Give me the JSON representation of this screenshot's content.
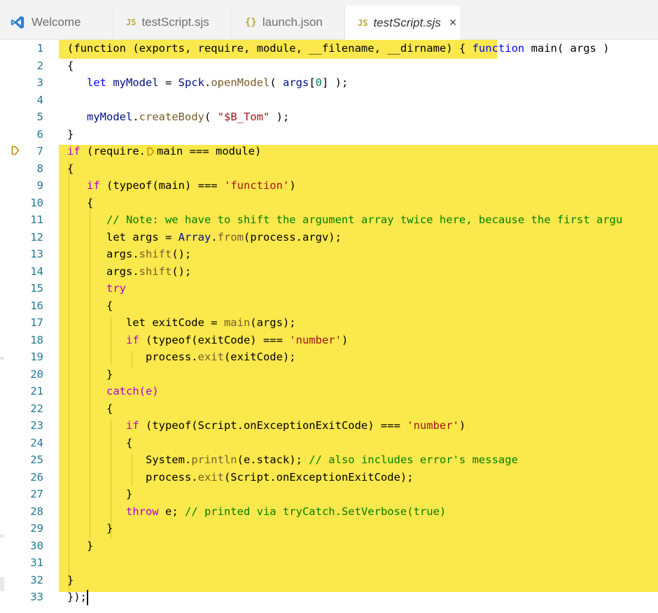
{
  "tabs": [
    {
      "icon": "vscode-logo-icon",
      "label": "Welcome"
    },
    {
      "icon": "JS",
      "label": "testScript.sjs"
    },
    {
      "icon": "{}",
      "label": "launch.json"
    },
    {
      "icon": "JS",
      "label": "testScript.sjs",
      "close": "×"
    }
  ],
  "editor": {
    "lines": [
      {
        "n": "1"
      },
      {
        "n": "2"
      },
      {
        "n": "3"
      },
      {
        "n": "4"
      },
      {
        "n": "5"
      },
      {
        "n": "6"
      },
      {
        "n": "7"
      },
      {
        "n": "8"
      },
      {
        "n": "9"
      },
      {
        "n": "10"
      },
      {
        "n": "11"
      },
      {
        "n": "12"
      },
      {
        "n": "13"
      },
      {
        "n": "14"
      },
      {
        "n": "15"
      },
      {
        "n": "16"
      },
      {
        "n": "17"
      },
      {
        "n": "18"
      },
      {
        "n": "19"
      },
      {
        "n": "20"
      },
      {
        "n": "21"
      },
      {
        "n": "22"
      },
      {
        "n": "23"
      },
      {
        "n": "24"
      },
      {
        "n": "25"
      },
      {
        "n": "26"
      },
      {
        "n": "27"
      },
      {
        "n": "28"
      },
      {
        "n": "29"
      },
      {
        "n": "30"
      },
      {
        "n": "31"
      },
      {
        "n": "32"
      },
      {
        "n": "33"
      }
    ],
    "code": {
      "l1a": "(function (exports, require, module, __filename, __dirname) { ",
      "l1b": "function",
      "l1c": " main( args )",
      "l2": "{",
      "l3a": "   let",
      "l3b": " myModel",
      "l3c": " = ",
      "l3d": "Spck",
      "l3e": ".",
      "l3f": "openModel",
      "l3g": "( ",
      "l3h": "args",
      "l3i": "[",
      "l3j": "0",
      "l3k": "] );",
      "l5a": "   myModel",
      "l5b": ".",
      "l5c": "createBody",
      "l5d": "( ",
      "l5e": "\"$B_Tom\"",
      "l5f": " );",
      "l6": "}",
      "l7a": "if",
      "l7b": " (require.",
      "l7c": "main === module)",
      "l8": "{",
      "l9a": "   if",
      "l9b": " (typeof(main) === ",
      "l9c": "'function'",
      "l9d": ")",
      "l10": "   {",
      "l11": "      // Note: we have to shift the argument array twice here, because the first argu",
      "l12a": "      let args = ",
      "l12b": "Array",
      "l12c": ".",
      "l12d": "from",
      "l12e": "(process.argv);",
      "l13a": "      args.",
      "l13b": "shift",
      "l13c": "();",
      "l14a": "      args.",
      "l14b": "shift",
      "l14c": "();",
      "l15": "      try",
      "l16": "      {",
      "l17a": "         let exitCode = ",
      "l17b": "main",
      "l17c": "(args);",
      "l18a": "         if",
      "l18b": " (typeof(exitCode) === ",
      "l18c": "'number'",
      "l18d": ")",
      "l19a": "            process.",
      "l19b": "exit",
      "l19c": "(exitCode);",
      "l20": "      }",
      "l21": "      catch(e)",
      "l22": "      {",
      "l23a": "         if",
      "l23b": " (typeof(Script.onExceptionExitCode) === ",
      "l23c": "'number'",
      "l23d": ")",
      "l24": "         {",
      "l25a": "            System.",
      "l25b": "println",
      "l25c": "(e.stack); ",
      "l25d": "// also includes error's message",
      "l26a": "            process.",
      "l26b": "exit",
      "l26c": "(Script.onExceptionExitCode);",
      "l27": "         }",
      "l28a": "         throw",
      "l28b": " e; ",
      "l28c": "// printed via tryCatch.SetVerbose(true)",
      "l29": "      }",
      "l30": "   }",
      "l32": "}",
      "l33": "});"
    }
  },
  "colors": {
    "highlight": "#fbe84c",
    "line_number": "#237893",
    "keyword_control": "#af00db",
    "keyword": "#0000ff",
    "string": "#a31515",
    "comment": "#008000",
    "function": "#795e26"
  }
}
